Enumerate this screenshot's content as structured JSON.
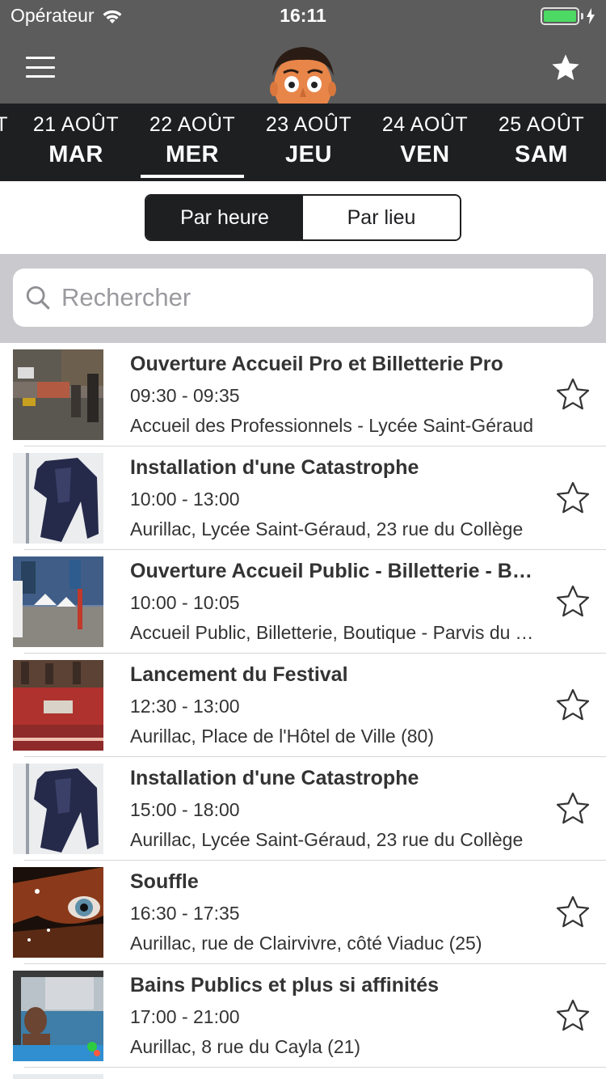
{
  "status": {
    "carrier": "Opérateur",
    "time": "16:11"
  },
  "nav": {
    "menu_icon": "hamburger-icon",
    "logo_icon": "mascot-face-logo",
    "favorites_icon": "star-filled-icon"
  },
  "dates": {
    "partial_left": "T",
    "items": [
      {
        "date": "21 AOÛT",
        "weekday": "MAR"
      },
      {
        "date": "22 AOÛT",
        "weekday": "MER"
      },
      {
        "date": "23 AOÛT",
        "weekday": "JEU"
      },
      {
        "date": "24 AOÛT",
        "weekday": "VEN"
      },
      {
        "date": "25 AOÛT",
        "weekday": "SAM"
      }
    ],
    "selected": "22 AOÛT"
  },
  "segmented": {
    "by_hour": "Par heure",
    "by_place": "Par lieu",
    "selected": "Par heure"
  },
  "search": {
    "placeholder": "Rechercher",
    "value": ""
  },
  "events": [
    {
      "title": "Ouverture Accueil Pro et Billetterie Pro",
      "time": "09:30 - 09:35",
      "place": "Accueil des Professionnels - Lycée Saint-Géraud",
      "favorite": false
    },
    {
      "title": "Installation d'une Catastrophe",
      "time": "10:00 - 13:00",
      "place": "Aurillac, Lycée Saint-Géraud, 23 rue du Collège",
      "favorite": false
    },
    {
      "title": "Ouverture Accueil Public - Billetterie - Boutique",
      "time": "10:00 - 10:05",
      "place": "Accueil Public, Billetterie, Boutique - Parvis du Théâtre",
      "favorite": false
    },
    {
      "title": "Lancement du Festival",
      "time": "12:30 - 13:00",
      "place": "Aurillac, Place de l'Hôtel de Ville (80)",
      "favorite": false
    },
    {
      "title": "Installation d'une Catastrophe",
      "time": "15:00 - 18:00",
      "place": "Aurillac, Lycée Saint-Géraud, 23 rue du Collège",
      "favorite": false
    },
    {
      "title": "Souffle",
      "time": "16:30 - 17:35",
      "place": "Aurillac, rue de Clairvivre, côté Viaduc (25)",
      "favorite": false
    },
    {
      "title": "Bains Publics et plus si affinités",
      "time": "17:00 - 21:00",
      "place": "Aurillac, 8 rue du Cayla (21)",
      "favorite": false
    }
  ],
  "colors": {
    "navbar": "#5c5c5c",
    "datebar": "#1e1f21",
    "search_bg": "#c9c9ce",
    "battery": "#4cd964"
  }
}
